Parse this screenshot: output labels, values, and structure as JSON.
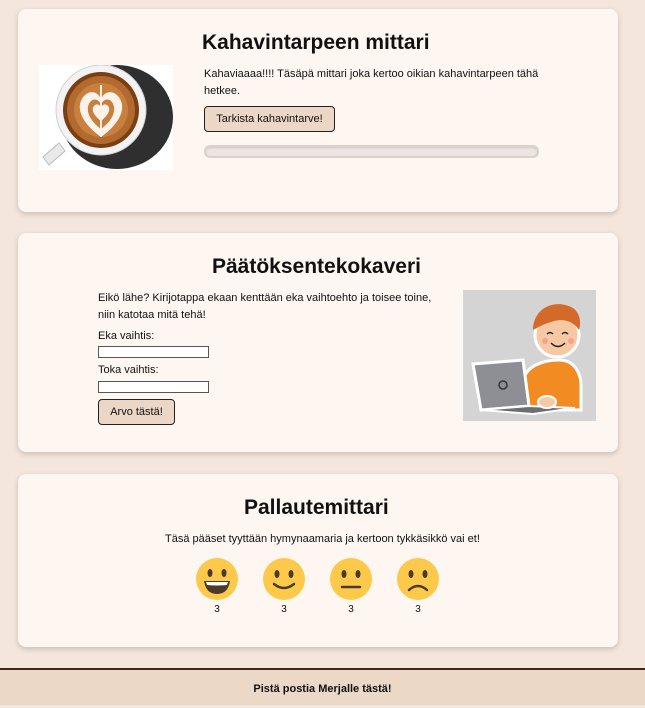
{
  "coffee": {
    "title": "Kahavintarpeen mittari",
    "description": "Kahaviaaaa!!!! Täsäpä mittari joka kertoo oikian kahavintarpeen tähä hetkee.",
    "button_label": "Tarkista kahavintarve!",
    "progress": 0
  },
  "decision": {
    "title": "Päätöksentekokaveri",
    "description": "Eikö lähe? Kirijotappa ekaan kenttään eka vaihtoehto ja toisee toine, niin katotaa mitä tehä!",
    "option1_label": "Eka vaihtis:",
    "option1_value": "",
    "option2_label": "Toka vaihtis:",
    "option2_value": "",
    "button_label": "Arvo tästä!"
  },
  "feedback": {
    "title": "Pallautemittari",
    "description": "Täsä pääset tyyttään hymynaamaria ja kertoon tykkäsikkö vai et!",
    "faces": [
      {
        "icon": "grinning-face-icon",
        "count": "3"
      },
      {
        "icon": "smiling-face-icon",
        "count": "3"
      },
      {
        "icon": "neutral-face-icon",
        "count": "3"
      },
      {
        "icon": "frowning-face-icon",
        "count": "3"
      }
    ]
  },
  "footer": {
    "text": "Pistä postia Merjalle tästä!"
  },
  "colors": {
    "page_bg": "#f4e6dc",
    "card_bg": "#fef6f1",
    "button_bg": "#ecd6c6",
    "emoji_yellow": "#fdc94a"
  }
}
